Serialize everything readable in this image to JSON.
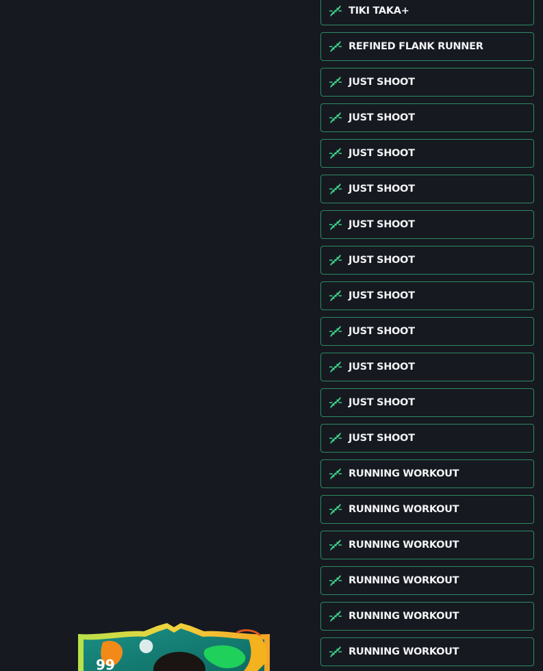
{
  "chemistry_styles": [
    {
      "label": "TIKI TAKA+",
      "icon": "dna-icon"
    },
    {
      "label": "REFINED FLANK RUNNER",
      "icon": "dna-icon"
    },
    {
      "label": "JUST SHOOT",
      "icon": "dna-icon"
    },
    {
      "label": "JUST SHOOT",
      "icon": "dna-icon"
    },
    {
      "label": "JUST SHOOT",
      "icon": "dna-icon"
    },
    {
      "label": "JUST SHOOT",
      "icon": "dna-icon"
    },
    {
      "label": "JUST SHOOT",
      "icon": "dna-icon"
    },
    {
      "label": "JUST SHOOT",
      "icon": "dna-icon"
    },
    {
      "label": "JUST SHOOT",
      "icon": "dna-icon"
    },
    {
      "label": "JUST SHOOT",
      "icon": "dna-icon"
    },
    {
      "label": "JUST SHOOT",
      "icon": "dna-icon"
    },
    {
      "label": "JUST SHOOT",
      "icon": "dna-icon"
    },
    {
      "label": "JUST SHOOT",
      "icon": "dna-icon"
    },
    {
      "label": "RUNNING WORKOUT",
      "icon": "dna-icon"
    },
    {
      "label": "RUNNING WORKOUT",
      "icon": "dna-icon"
    },
    {
      "label": "RUNNING WORKOUT",
      "icon": "dna-icon"
    },
    {
      "label": "RUNNING WORKOUT",
      "icon": "dna-icon"
    },
    {
      "label": "RUNNING WORKOUT",
      "icon": "dna-icon"
    },
    {
      "label": "RUNNING WORKOUT",
      "icon": "dna-icon"
    }
  ],
  "player_card": {
    "rating": "99"
  },
  "colors": {
    "background": "#161920",
    "accent": "#2f8a66",
    "icon": "#3fd68f",
    "text": "#f2f3f5"
  }
}
